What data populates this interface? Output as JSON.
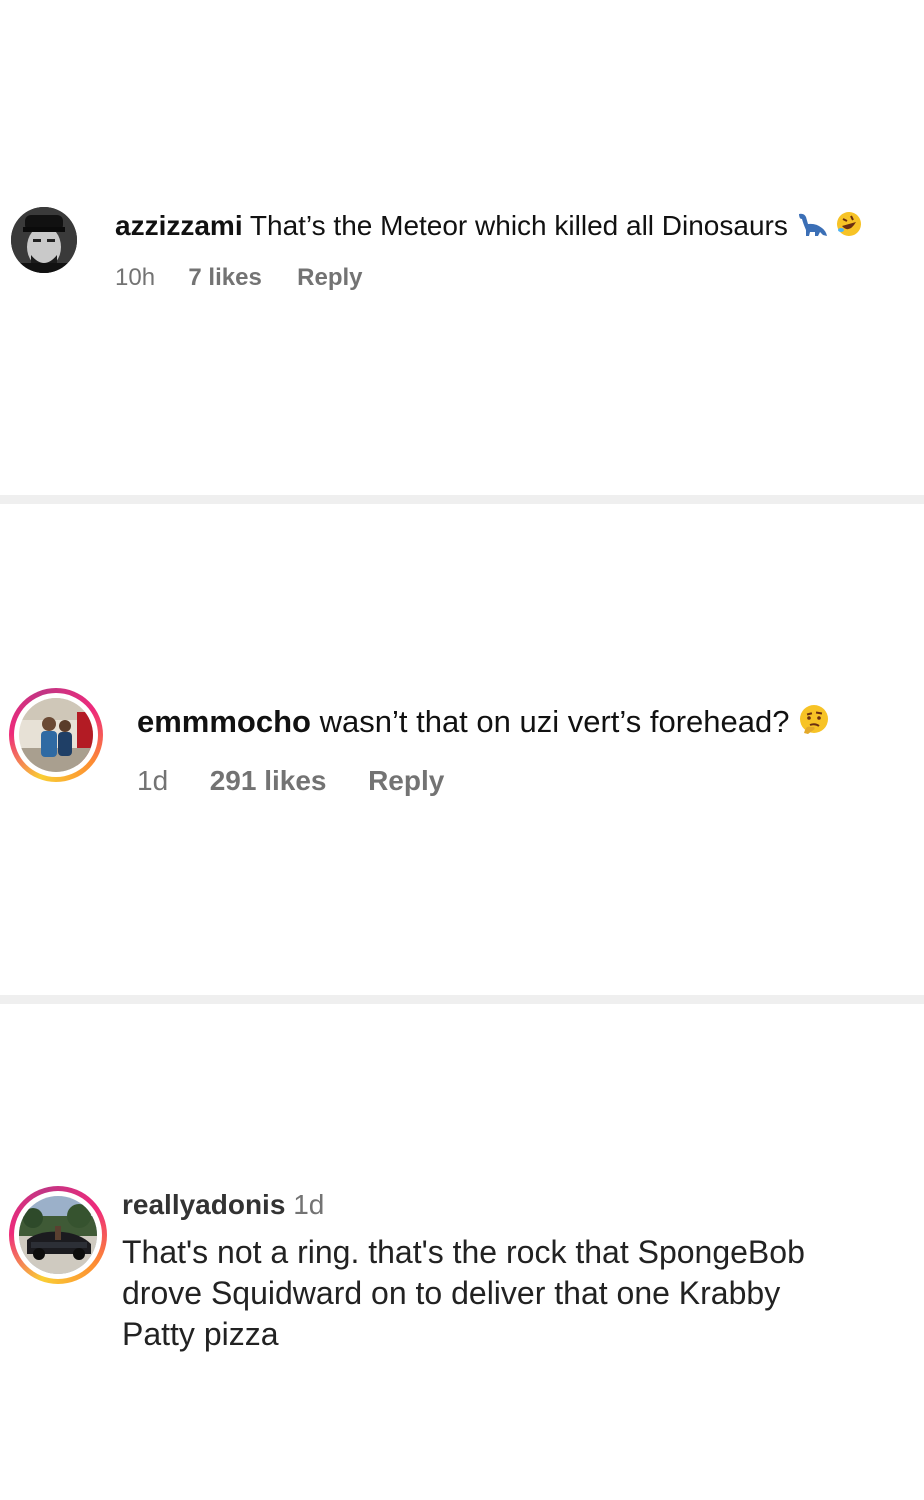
{
  "comments": [
    {
      "username": "azzizzami",
      "text": "That’s the Meteor which killed all Dinosaurs",
      "emojis": [
        "dinosaur-icon",
        "rofl-emoji-icon"
      ],
      "time": "10h",
      "likes": "7 likes",
      "reply_label": "Reply"
    },
    {
      "username": "emmmocho",
      "text": "wasn’t that on uzi vert’s forehead?",
      "emojis": [
        "thinking-emoji-icon"
      ],
      "time": "1d",
      "likes": "291 likes",
      "reply_label": "Reply"
    },
    {
      "username": "reallyadonis",
      "time": "1d",
      "text_lines": [
        "That's not a ring. that's the rock that SpongeBob",
        "drove Squidward on to deliver that one Krabby",
        "Patty pizza"
      ]
    }
  ],
  "colors": {
    "divider": "#efefef",
    "meta_text": "#737373",
    "story_ring_start": "#f9ce34",
    "story_ring_mid": "#ee2a7b",
    "story_ring_end": "#c13584"
  }
}
